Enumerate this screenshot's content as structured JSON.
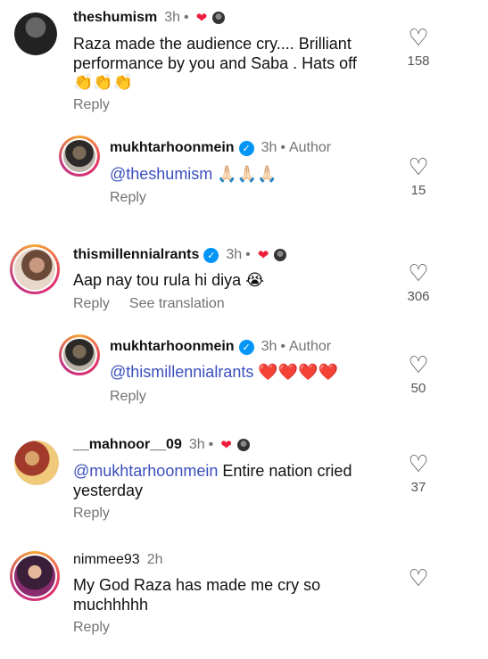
{
  "comments": [
    {
      "username": "theshumism",
      "time": "3h",
      "text": "Raza made the audience cry.... Brilliant performance by you and Saba . Hats off",
      "emoji": "👏👏👏",
      "reply_label": "Reply",
      "likes": "158"
    },
    {
      "username": "mukhtarhoonmein",
      "time": "3h",
      "author_label": "Author",
      "mention": "@theshumism",
      "text": "🙏🏻🙏🏻🙏🏻",
      "reply_label": "Reply",
      "likes": "15"
    },
    {
      "username": "thismillennialrants",
      "time": "3h",
      "text": "Aap nay tou rula hi diya",
      "emoji": "😭",
      "reply_label": "Reply",
      "translate_label": "See translation",
      "likes": "306"
    },
    {
      "username": "mukhtarhoonmein",
      "time": "3h",
      "author_label": "Author",
      "mention": "@thismillennialrants",
      "text": "❤️❤️❤️❤️",
      "reply_label": "Reply",
      "likes": "50"
    },
    {
      "username": "__mahnoor__09",
      "time": "3h",
      "mention": "@mukhtarhoonmein",
      "text_line1": "Entire nation cried",
      "text_line2": "yesterday",
      "reply_label": "Reply",
      "likes": "37"
    },
    {
      "username": "nimmee93",
      "time": "2h",
      "text_line1": "My God Raza has made me cry so",
      "text_line2": "muchhhhh",
      "reply_label": "Reply"
    }
  ],
  "icons": {
    "heart_outline": "heart-outline-icon",
    "heart_filled": "heart-filled-icon",
    "verified": "verified-badge-icon"
  },
  "colors": {
    "mention": "#3b4fbe",
    "verified": "#0095f6",
    "creator_heart": "#ed1c3b",
    "muted": "#737373"
  }
}
